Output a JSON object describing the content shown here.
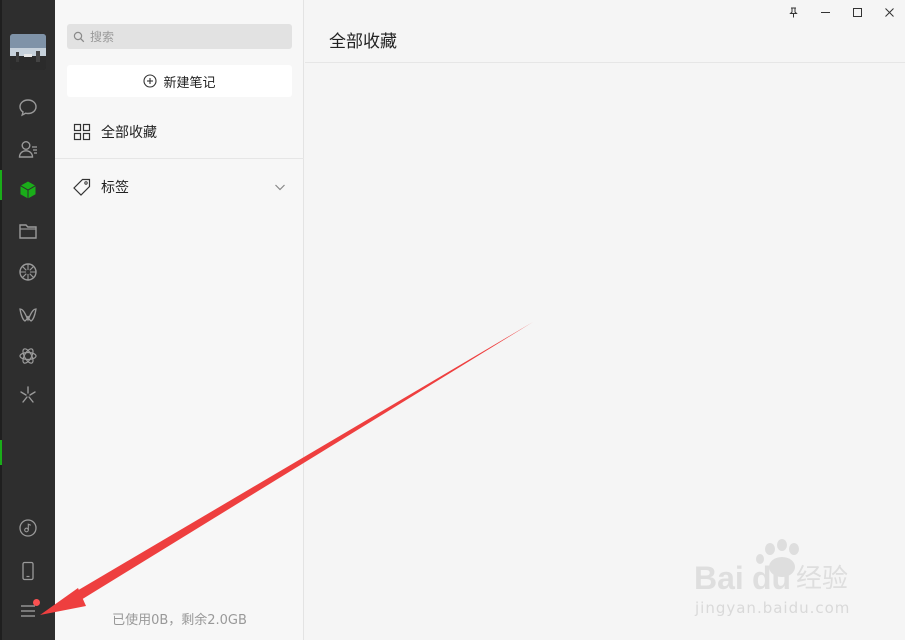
{
  "sidebar": {
    "items": [
      {
        "name": "chat-icon"
      },
      {
        "name": "contacts-icon"
      },
      {
        "name": "favorites-icon",
        "active": true
      },
      {
        "name": "files-icon"
      },
      {
        "name": "moments-icon"
      },
      {
        "name": "channels-icon"
      },
      {
        "name": "mini-programs-icon"
      },
      {
        "name": "search-network-icon"
      }
    ],
    "bottom_items": [
      {
        "name": "music-icon"
      },
      {
        "name": "phone-icon"
      },
      {
        "name": "menu-icon"
      }
    ]
  },
  "middle": {
    "search_placeholder": "搜索",
    "new_note_label": "新建笔记",
    "all_favorites_label": "全部收藏",
    "tags_label": "标签",
    "storage_text": "已使用0B，剩余2.0GB"
  },
  "main": {
    "title": "全部收藏"
  },
  "watermark": {
    "logo_text": "Bai",
    "logo_text2": "du",
    "brand_cn": "经验",
    "url": "jingyan.baidu.com"
  },
  "colors": {
    "accent": "#1aad19",
    "rail_bg": "#2e2e2e",
    "annotation_arrow": "#ee3f3f"
  }
}
